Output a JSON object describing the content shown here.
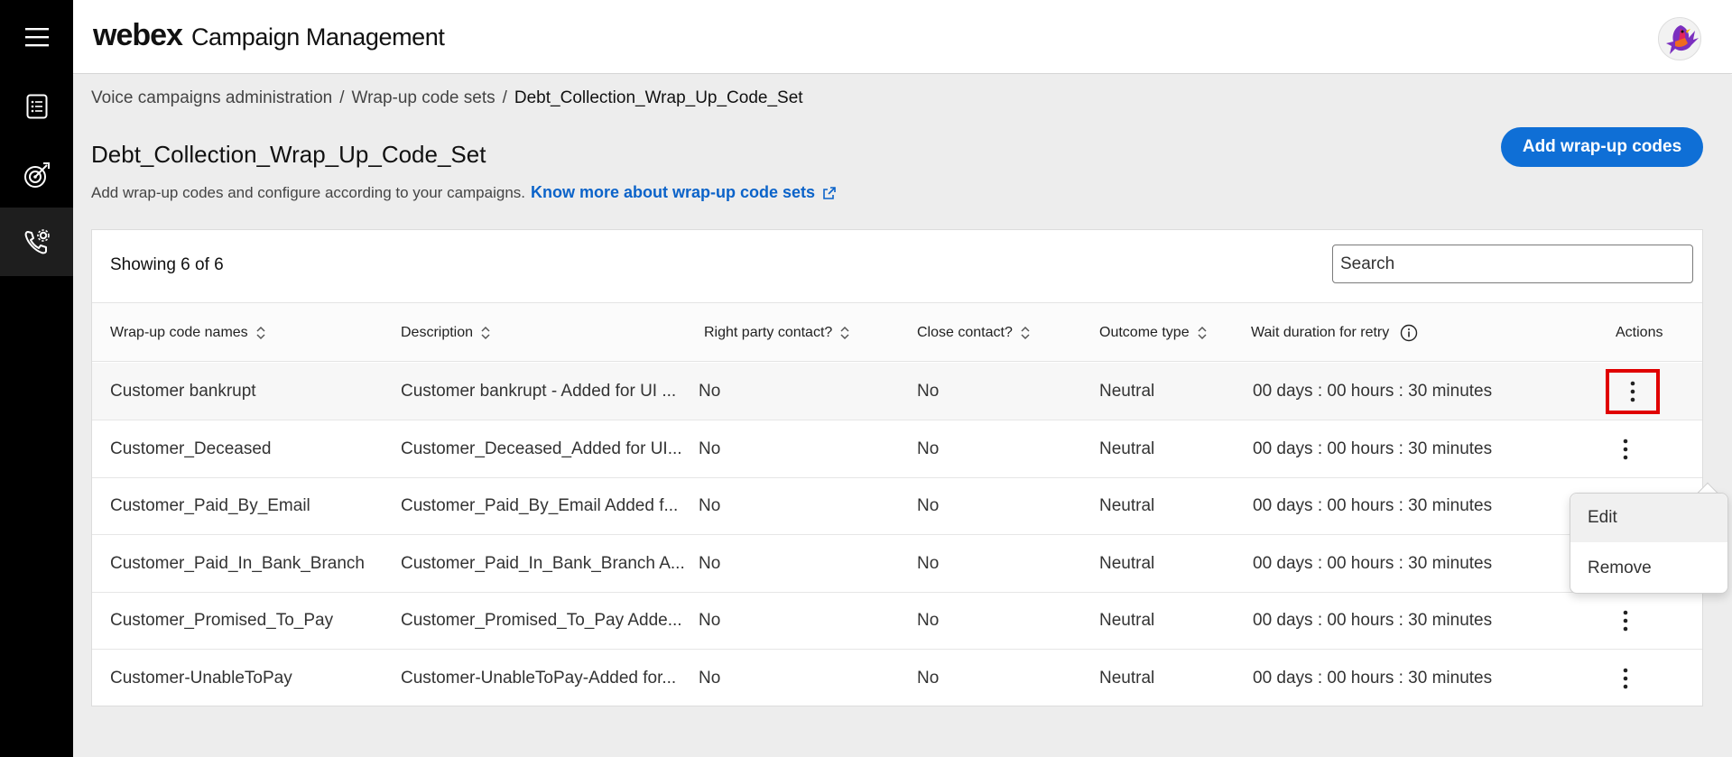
{
  "app": {
    "logo": "webex",
    "title": "Campaign Management"
  },
  "rail": {
    "items": [
      {
        "name": "menu-icon"
      },
      {
        "name": "list-icon"
      },
      {
        "name": "target-icon"
      },
      {
        "name": "phone-settings-icon"
      }
    ]
  },
  "breadcrumb": {
    "items": [
      "Voice campaigns administration",
      "Wrap-up code sets",
      "Debt_Collection_Wrap_Up_Code_Set"
    ],
    "separator": "/"
  },
  "page": {
    "title": "Debt_Collection_Wrap_Up_Code_Set",
    "subtitle": "Add wrap-up codes and configure according to your campaigns.",
    "link": "Know more about wrap-up code sets",
    "primary_button": "Add wrap-up codes"
  },
  "table": {
    "showing": "Showing 6 of 6",
    "search_placeholder": "Search",
    "columns": [
      "Wrap-up code names",
      "Description",
      "Right party contact?",
      "Close contact?",
      "Outcome type",
      "Wait duration for retry",
      "Actions"
    ],
    "rows": [
      [
        "Customer bankrupt",
        "Customer bankrupt - Added for UI ...",
        "No",
        "No",
        "Neutral",
        "00 days : 00 hours : 30 minutes"
      ],
      [
        "Customer_Deceased",
        "Customer_Deceased_Added for UI...",
        "No",
        "No",
        "Neutral",
        "00 days : 00 hours : 30 minutes"
      ],
      [
        "Customer_Paid_By_Email",
        "Customer_Paid_By_Email Added f...",
        "No",
        "No",
        "Neutral",
        "00 days : 00 hours : 30 minutes"
      ],
      [
        "Customer_Paid_In_Bank_Branch",
        "Customer_Paid_In_Bank_Branch A...",
        "No",
        "No",
        "Neutral",
        "00 days : 00 hours : 30 minutes"
      ],
      [
        "Customer_Promised_To_Pay",
        "Customer_Promised_To_Pay Adde...",
        "No",
        "No",
        "Neutral",
        "00 days : 00 hours : 30 minutes"
      ],
      [
        "Customer-UnableToPay",
        "Customer-UnableToPay-Added for...",
        "No",
        "No",
        "Neutral",
        "00 days : 00 hours : 30 minutes"
      ]
    ]
  },
  "menu": {
    "items": [
      "Edit",
      "Remove"
    ]
  },
  "colors": {
    "accent": "#0f6fd6",
    "link": "#0b63c9",
    "focus": "#e00000",
    "rail": "#000000"
  }
}
